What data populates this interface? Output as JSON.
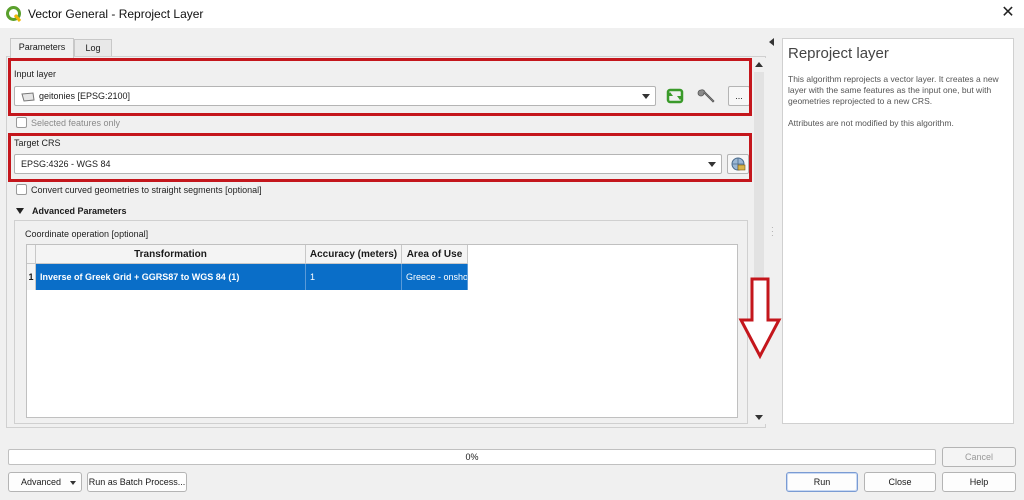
{
  "window": {
    "title": "Vector General - Reproject Layer",
    "close_glyph": "✕"
  },
  "tabs": [
    {
      "label": "Parameters",
      "active": true
    },
    {
      "label": "Log",
      "active": false
    }
  ],
  "params": {
    "input_layer_label": "Input layer",
    "input_layer_value": "geitonies [EPSG:2100]",
    "selected_features_label": "Selected features only",
    "target_crs_label": "Target CRS",
    "target_crs_value": "EPSG:4326 - WGS 84",
    "convert_curves_label": "Convert curved geometries to straight segments [optional]",
    "advanced_label": "Advanced Parameters",
    "coord_op_label": "Coordinate operation [optional]",
    "ellipsis_label": "..."
  },
  "table": {
    "columns": [
      "Transformation",
      "Accuracy (meters)",
      "Area of Use"
    ],
    "rows": [
      {
        "index": "1",
        "transformation": "Inverse of Greek Grid + GGRS87 to WGS 84 (1)",
        "accuracy": "1",
        "area": "Greece - onshore."
      }
    ]
  },
  "help": {
    "title": "Reproject layer",
    "description": "This algorithm reprojects a vector layer. It creates a new layer with the same features as the input one, but with geometries reprojected to a new CRS.",
    "note": "Attributes are not modified by this algorithm."
  },
  "progress": {
    "percent": 0,
    "text": "0%"
  },
  "buttons": {
    "cancel": "Cancel",
    "advanced": "Advanced",
    "batch": "Run as Batch Process...",
    "run": "Run",
    "close": "Close",
    "help": "Help"
  },
  "colors": {
    "highlight_red": "#c4161c",
    "selection_blue": "#0a6ec8",
    "qgis_green": "#5aa02c"
  },
  "icons": [
    "qgis-logo-icon",
    "polygon-layer-icon",
    "iterate-icon",
    "wrench-icon",
    "crs-globe-icon",
    "dropdown-arrow-icon",
    "collapse-triangle-icon",
    "down-arrow-annotation-icon"
  ]
}
